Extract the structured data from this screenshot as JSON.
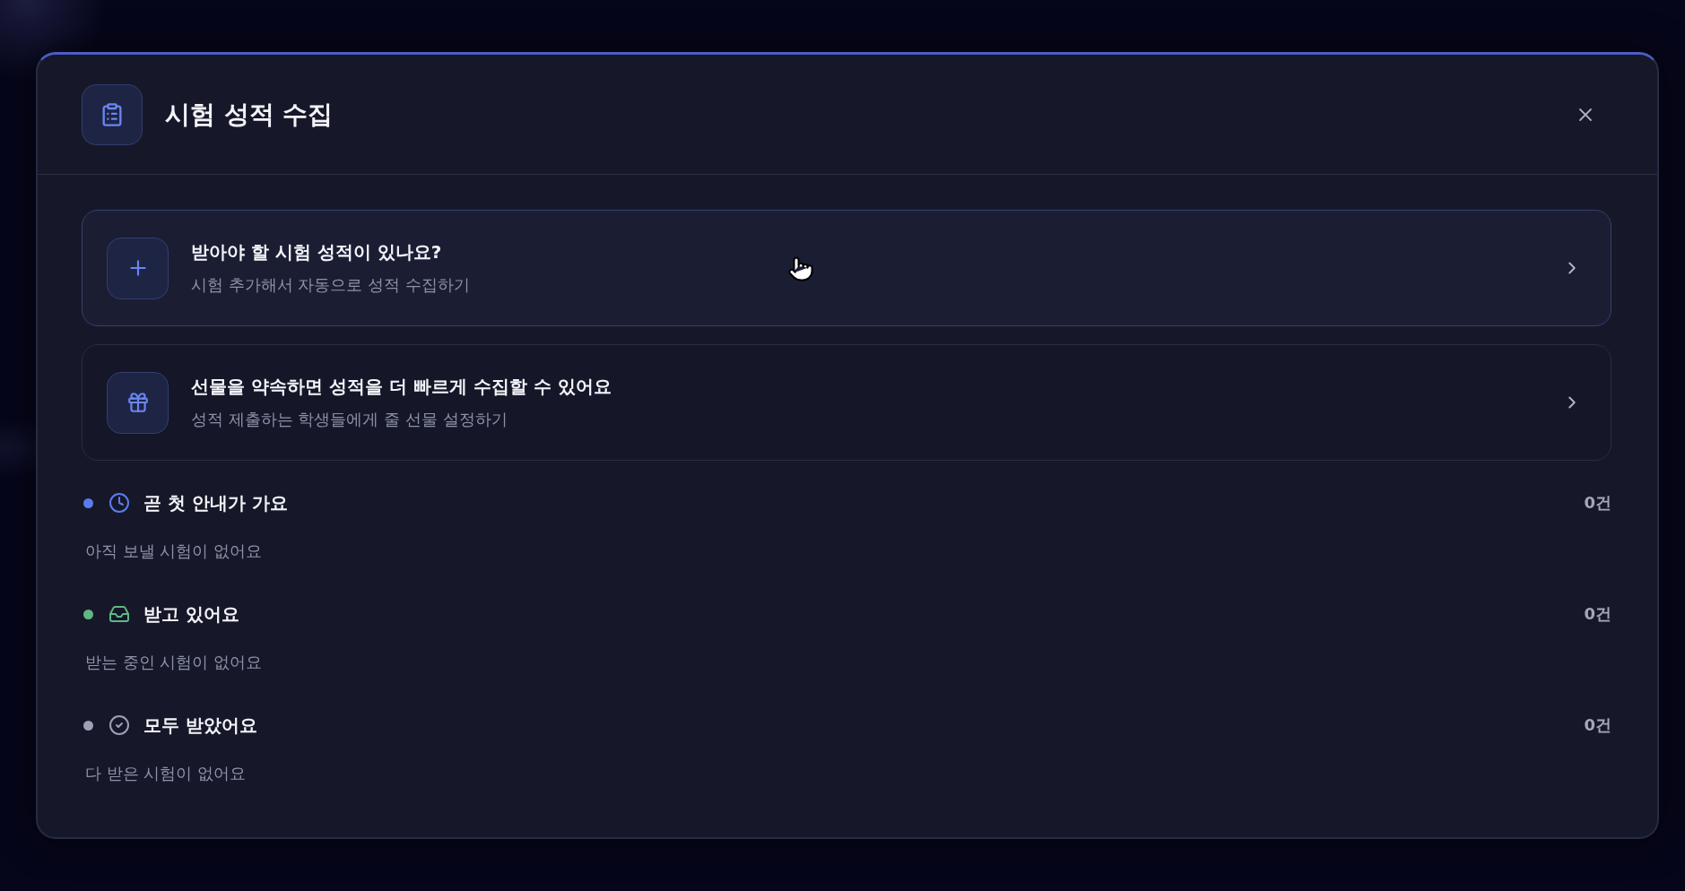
{
  "dialog": {
    "title": "시험 성적 수집"
  },
  "action_cards": [
    {
      "kind": "add",
      "title": "받아야 할 시험 성적이 있나요?",
      "subtitle": "시험 추가해서 자동으로 성적 수집하기",
      "hovered": true
    },
    {
      "kind": "gift",
      "title": "선물을 약속하면 성적을 더 빠르게 수집할 수 있어요",
      "subtitle": "성적 제출하는 학생들에게 줄 선물 설정하기",
      "hovered": false
    }
  ],
  "sections": [
    {
      "kind": "scheduled",
      "color": "#5b7cf0",
      "title": "곧 첫 안내가 가요",
      "count": "0건",
      "empty_text": "아직 보낼 시험이 없어요"
    },
    {
      "kind": "receiving",
      "color": "#5fb883",
      "title": "받고 있어요",
      "count": "0건",
      "empty_text": "받는 중인 시험이 없어요"
    },
    {
      "kind": "done",
      "color": "#9ca1b6",
      "title": "모두 받았어요",
      "count": "0건",
      "empty_text": "다 받은 시험이 없어요"
    }
  ]
}
